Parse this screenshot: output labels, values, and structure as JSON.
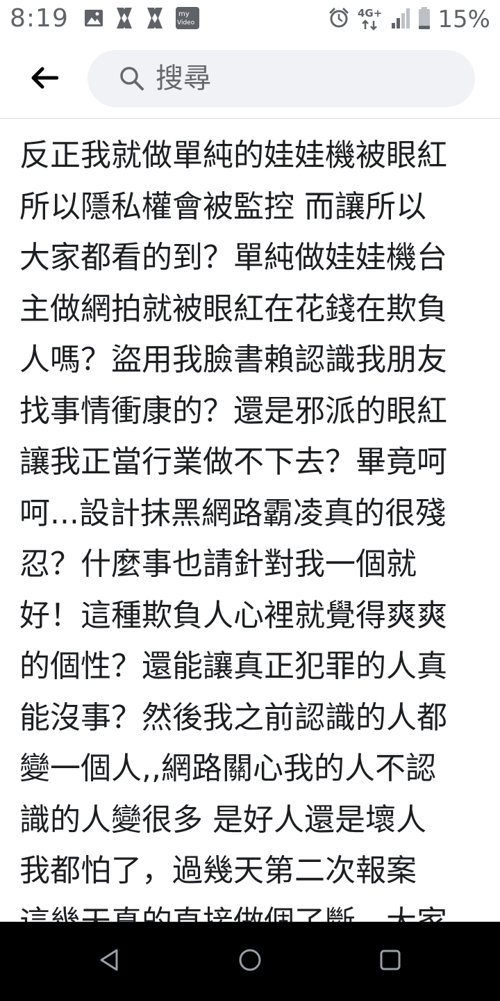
{
  "status_bar": {
    "time": "8:19",
    "network": "4G+",
    "battery": "15%",
    "icons": [
      "image-icon",
      "app-icon",
      "app-icon",
      "myvideo-icon",
      "alarm-icon",
      "signal-icon",
      "battery-icon"
    ],
    "myvideo_label_top": "my",
    "myvideo_label_bottom": "Video"
  },
  "header": {
    "back_icon": "arrow-left-icon",
    "search_icon": "search-icon",
    "search_placeholder": "搜尋"
  },
  "post": {
    "lines": [
      "反正我就做單純的娃娃機被眼紅",
      "所以隱私權會被監控 而讓所以",
      "大家都看的到？單純做娃娃機台",
      "主做網拍就被眼紅在花錢在欺負",
      "人嗎？盜用我臉書賴認識我朋友",
      "找事情衝康的？還是邪派的眼紅",
      "讓我正當行業做不下去？畢竟呵",
      "呵...設計抹黑網路霸凌真的很殘",
      "忍？什麼事也請針對我一個就",
      "好！這種欺負人心裡就覺得爽爽",
      "的個性？還能讓真正犯罪的人真",
      "能沒事？然後我之前認識的人都",
      "變一個人,,網路關心我的人不認",
      "識的人變很多 是好人還是壞人",
      "我都怕了，過幾天第二次報案",
      "這幾天真的直接做個了斷。大家"
    ]
  },
  "nav_bar": {
    "icons": [
      "nav-back-icon",
      "nav-home-icon",
      "nav-recents-icon"
    ]
  },
  "colors": {
    "status_text": "#5f6368",
    "search_bg": "#f0f2f5",
    "text": "#1c1e21",
    "nav_bg": "#000000"
  }
}
